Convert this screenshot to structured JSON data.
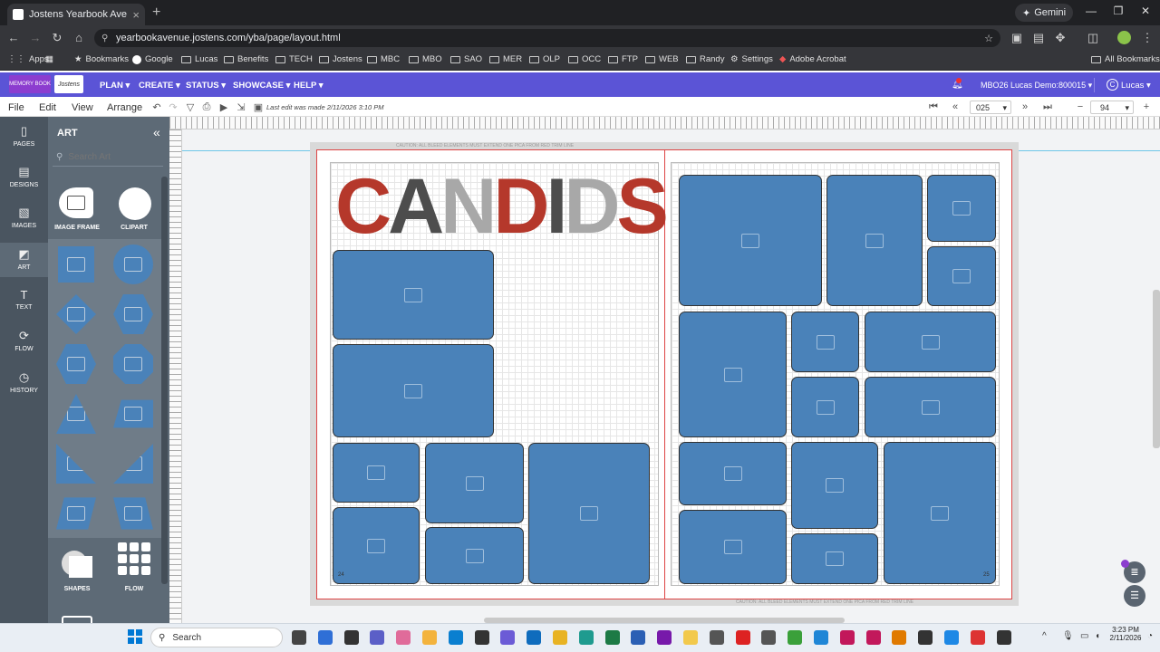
{
  "browser": {
    "tab_title": "Jostens Yearbook Avenue: Layo",
    "gemini": "Gemini",
    "url": "yearbookavenue.jostens.com/yba/page/layout.html",
    "bookmarks": [
      "Apps",
      "Bookmarks",
      "Google",
      "Lucas",
      "Benefits",
      "TECH",
      "Jostens",
      "MBC",
      "MBO",
      "SAO",
      "MER",
      "OLP",
      "OCC",
      "FTP",
      "WEB",
      "Randy",
      "Settings",
      "Adobe Acrobat"
    ],
    "all_bookmarks": "All Bookmarks"
  },
  "app_nav": {
    "logo1": "MEMORY BOOK",
    "logo2": "Jostens",
    "menus": [
      "PLAN ▾",
      "CREATE ▾",
      "STATUS ▾",
      "SHOWCASE ▾",
      "HELP ▾"
    ],
    "account": "MBO26 Lucas Demo:800015 ▾",
    "user": "Lucas ▾",
    "user_initial": "C"
  },
  "menubar": {
    "items": [
      "File",
      "Edit",
      "View",
      "Arrange"
    ],
    "last_edit": "Last edit was made 2/11/2026 3:10 PM",
    "page_number": "025",
    "zoom": "94"
  },
  "left_rail": [
    {
      "label": "PAGES",
      "icon": "pages-icon",
      "glyph": "▯"
    },
    {
      "label": "DESIGNS",
      "icon": "designs-icon",
      "glyph": "▤"
    },
    {
      "label": "IMAGES",
      "icon": "images-icon",
      "glyph": "▧"
    },
    {
      "label": "ART",
      "icon": "art-icon",
      "glyph": "◩"
    },
    {
      "label": "TEXT",
      "icon": "text-icon",
      "glyph": "T"
    },
    {
      "label": "FLOW",
      "icon": "flow-icon",
      "glyph": "⟳"
    },
    {
      "label": "HISTORY",
      "icon": "history-icon",
      "glyph": "◷"
    }
  ],
  "art_panel": {
    "title": "ART",
    "search_placeholder": "Search Art",
    "top_items": [
      "IMAGE FRAME",
      "CLIPART"
    ],
    "bottom_items": [
      "SHAPES",
      "FLOW"
    ]
  },
  "canvas": {
    "caution_top": "CAUTION: ALL BLEED ELEMENTS MUST EXTEND ONE PICA FROM RED TRIM LINE",
    "caution_bottom": "CAUTION: ALL BLEED ELEMENTS MUST EXTEND ONE PICA FROM RED TRIM LINE",
    "headline_letters": [
      {
        "ch": "C",
        "color": "#b5382b"
      },
      {
        "ch": "A",
        "color": "#4d4d4d"
      },
      {
        "ch": "N",
        "color": "#a8a8a8"
      },
      {
        "ch": "D",
        "color": "#b5382b"
      },
      {
        "ch": "I",
        "color": "#4d4d4d"
      },
      {
        "ch": "D",
        "color": "#a8a8a8"
      },
      {
        "ch": "S",
        "color": "#b5382b"
      }
    ],
    "left_page_number": "24",
    "right_page_number": "25"
  },
  "taskbar": {
    "search": "Search",
    "time": "3:23 PM",
    "date": "2/11/2026"
  }
}
